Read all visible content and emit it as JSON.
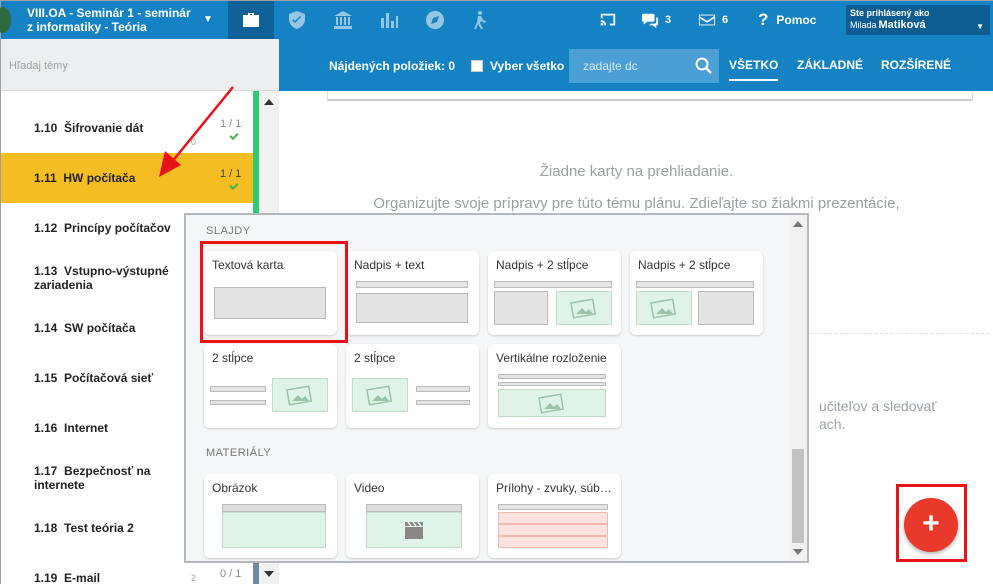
{
  "header": {
    "course_line1": "VIII.OA - Seminár 1 - seminár",
    "course_line2": "z informatiky - Teória",
    "nav_icons": [
      "briefcase-icon",
      "shield-icon",
      "bank-icon",
      "bar-chart-icon",
      "compass-icon",
      "hiking-icon"
    ],
    "chat_count": "3",
    "mail_count": "6",
    "help_label": "Pomoc",
    "user_label": "Ste prihlásený ako",
    "user_first": "Milada",
    "user_last": "Matiková"
  },
  "sidebar": {
    "search_placeholder": "Hľadaj témy",
    "topics": [
      {
        "num": "1.10",
        "title": "Šifrovanie dát",
        "score": "1 / 1",
        "small": "0"
      },
      {
        "num": "1.11",
        "title": "HW počítača",
        "score": "1 / 1"
      },
      {
        "num": "1.12",
        "title": "Princípy počítačov"
      },
      {
        "num": "1.13",
        "title": "Vstupno-výstupné zariadenia"
      },
      {
        "num": "1.14",
        "title": "SW počítača"
      },
      {
        "num": "1.15",
        "title": "Počítačová sieť"
      },
      {
        "num": "1.16",
        "title": "Internet"
      },
      {
        "num": "1.17",
        "title": "Bezpečnosť na internete"
      },
      {
        "num": "1.18",
        "title": "Test teória 2"
      },
      {
        "num": "1.19",
        "title": "E-mail",
        "score": "0 / 1",
        "small": "2"
      }
    ]
  },
  "content_header": {
    "found_label": "Nájdených položiek: 0",
    "select_all": "Vyber všetko",
    "search_placeholder": "zadajte dc",
    "tabs": [
      "VŠETKO",
      "ZÁKLADNÉ",
      "ROZŠÍRENÉ"
    ]
  },
  "content": {
    "empty_title": "Žiadne karty na prehliadanie.",
    "empty_text": "Organizujte svoje prípravy pre túto tému plánu. Zdieľajte so žiakmi prezentácie,",
    "behind_text_1": "učiteľov a sledovať",
    "behind_text_2": "ach."
  },
  "popup": {
    "section_slides": "SLAJDY",
    "section_materials": "MATERIÁLY",
    "slides": [
      "Textová karta",
      "Nadpis + text",
      "Nadpis + 2 stĺpce",
      "Nadpis + 2 stĺpce",
      "2 stĺpce",
      "2 stĺpce",
      "Vertikálne rozloženie"
    ],
    "materials": [
      "Obrázok",
      "Video",
      "Prílohy - zvuky, súbo..."
    ]
  },
  "fab_label": "+",
  "colors": {
    "primary": "#1582c4",
    "active_topic": "#f4bd22",
    "highlight": "#e8121a",
    "fab": "#e8392b"
  }
}
